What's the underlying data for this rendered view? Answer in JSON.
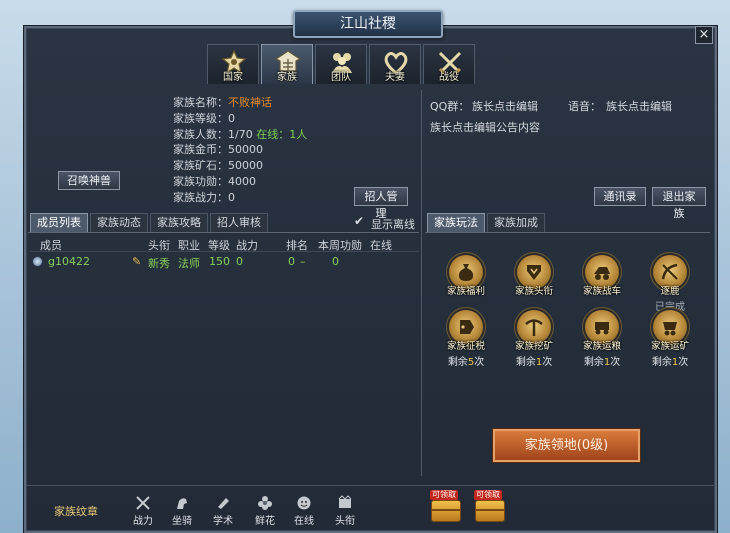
{
  "window": {
    "title": "江山社稷",
    "close": "×"
  },
  "top_tabs": [
    {
      "label": "国家",
      "icon": "country-emblem-icon"
    },
    {
      "label": "家族",
      "icon": "family-crest-icon",
      "active": true
    },
    {
      "label": "团队",
      "icon": "team-people-icon"
    },
    {
      "label": "夫妻",
      "icon": "heart-couple-icon"
    },
    {
      "label": "战役",
      "icon": "crossed-swords-icon"
    }
  ],
  "family_info": {
    "name_label": "家族名称：",
    "name": "不败神话",
    "level_label": "家族等级：",
    "level": "0",
    "members_label": "家族人数：",
    "members": "1/70",
    "online_label": "在线：",
    "online": "1人",
    "gold_label": "家族金币：",
    "gold": "50000",
    "ore_label": "家族矿石：",
    "ore": "50000",
    "merit_label": "家族功勋：",
    "merit": "4000",
    "power_label": "家族战力：",
    "power": "0"
  },
  "buttons": {
    "summon": "召唤神兽",
    "recruit": "招人管理",
    "contacts": "通讯录",
    "leave": "退出家族"
  },
  "left_tabs": [
    "成员列表",
    "家族动态",
    "家族攻略",
    "招人审核"
  ],
  "show_offline": "显示离线",
  "columns": [
    "成员",
    "头衔",
    "职业",
    "等级",
    "战力",
    "排名",
    "本周功勋",
    "在线"
  ],
  "members": [
    {
      "name": "g10422",
      "title": "新秀",
      "class": "法师",
      "level": "150",
      "power": "0",
      "rank": "0",
      "rank_dash": "–",
      "weekly": "0"
    }
  ],
  "right_info": {
    "qq_label": "QQ群：",
    "qq_value": "族长点击编辑",
    "voice_label": "语音：",
    "voice_value": "族长点击编辑",
    "notice": "族长点击编辑公告内容"
  },
  "right_tabs": [
    "家族玩法",
    "家族加成"
  ],
  "activities": [
    {
      "name": "家族福利",
      "icon": "money-bag-icon"
    },
    {
      "name": "家族头衔",
      "icon": "title-badge-icon"
    },
    {
      "name": "家族战车",
      "icon": "war-chariot-icon"
    },
    {
      "name": "逐鹿",
      "icon": "deer-hunt-icon",
      "status": "已完成"
    },
    {
      "name": "家族征税",
      "icon": "tax-tag-icon",
      "remain_pre": "剩余",
      "remain": "5",
      "remain_post": "次"
    },
    {
      "name": "家族挖矿",
      "icon": "pickaxe-icon",
      "remain_pre": "剩余",
      "remain": "1",
      "remain_post": "次"
    },
    {
      "name": "家族运粮",
      "icon": "grain-cart-icon",
      "remain_pre": "剩余",
      "remain": "1",
      "remain_post": "次"
    },
    {
      "name": "家族运矿",
      "icon": "ore-cart-icon",
      "remain_pre": "剩余",
      "remain": "1",
      "remain_post": "次"
    }
  ],
  "territory": "家族领地(0级)",
  "bottom": {
    "crest": "家族纹章",
    "icons": [
      {
        "label": "战力",
        "icon": "crossed-swords-icon"
      },
      {
        "label": "坐骑",
        "icon": "mount-icon"
      },
      {
        "label": "学术",
        "icon": "scroll-icon"
      },
      {
        "label": "鲜花",
        "icon": "flower-icon"
      },
      {
        "label": "在线",
        "icon": "smiley-icon"
      },
      {
        "label": "头衔",
        "icon": "title-icon"
      }
    ],
    "chests": [
      {
        "tag": "可领取"
      },
      {
        "tag": "可领取"
      }
    ]
  }
}
